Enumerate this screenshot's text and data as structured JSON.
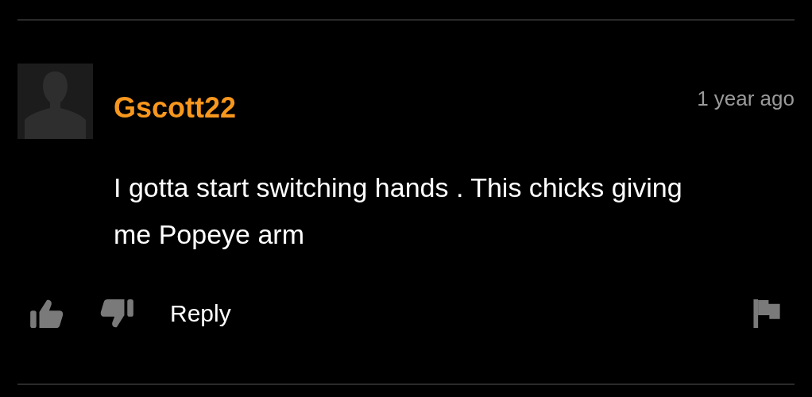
{
  "comment": {
    "username": "Gscott22",
    "time": "1 year ago",
    "text": "I gotta start switching hands . This chicks giving me Popeye arm",
    "reply_label": "Reply"
  }
}
